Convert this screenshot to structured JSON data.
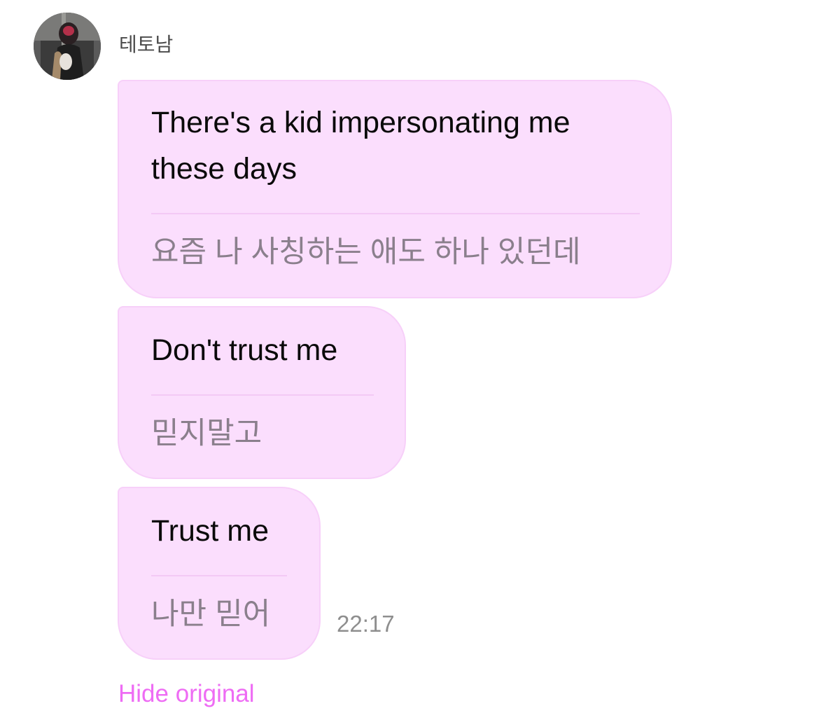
{
  "sender": {
    "name": "테토남",
    "avatar_icon": "profile-photo"
  },
  "messages": [
    {
      "translated": "There's a kid impersonating me these days",
      "original": "요즘 나 사칭하는 애도 하나 있던데"
    },
    {
      "translated": "Don't trust me",
      "original": "믿지말고"
    },
    {
      "translated": "Trust me",
      "original": "나만 믿어"
    }
  ],
  "timestamp": "22:17",
  "actions": {
    "hide_original_label": "Hide original"
  },
  "colors": {
    "bubble_background": "#fbdefd",
    "bubble_border": "#f7d0f9",
    "link_accent": "#ee6cf4",
    "original_text": "#8a7f8c"
  }
}
